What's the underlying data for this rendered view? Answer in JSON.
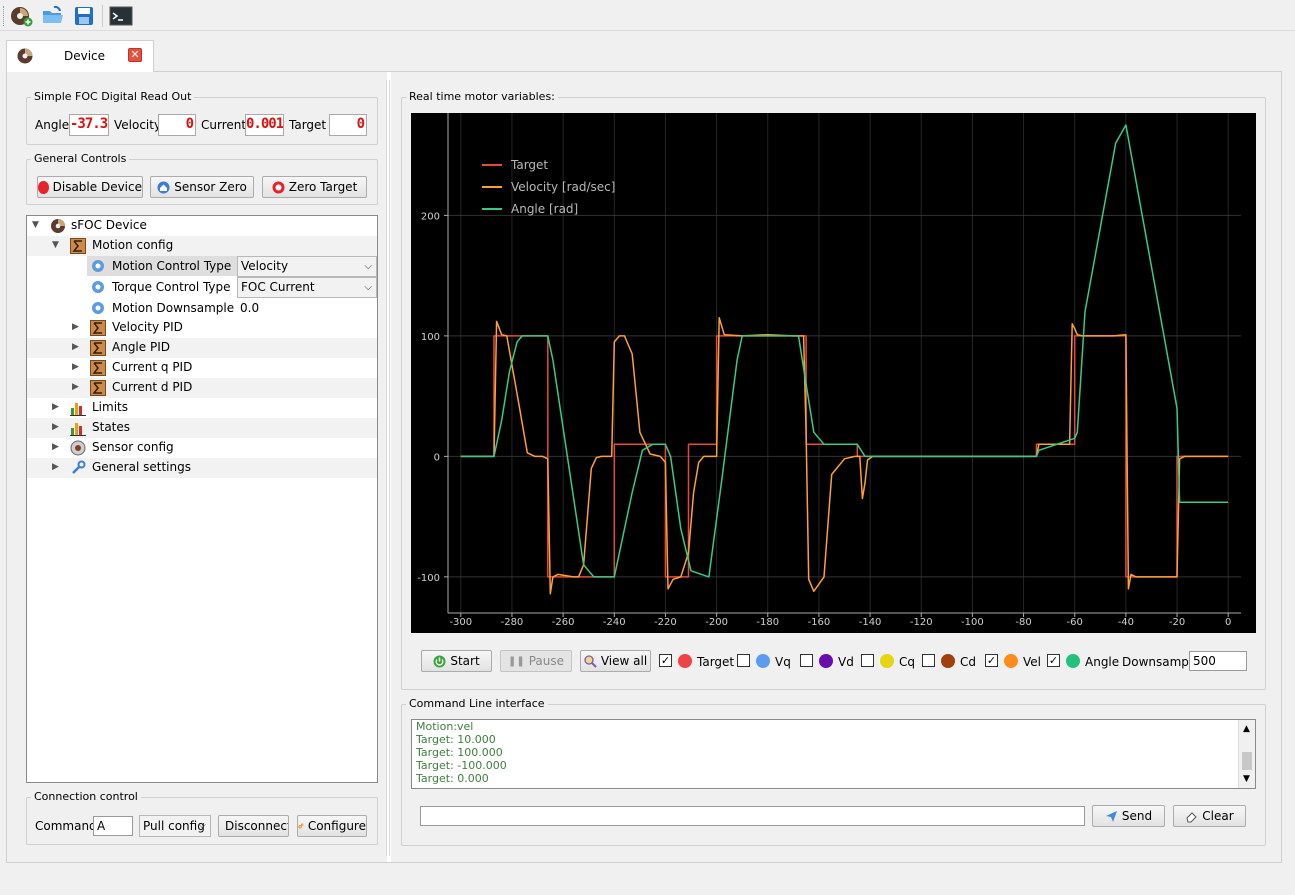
{
  "toolbar": {
    "icons": [
      "new-device-icon",
      "open-folder-icon",
      "save-icon",
      "terminal-icon"
    ]
  },
  "tab": {
    "label": "Device",
    "close_symbol": "✕"
  },
  "readout": {
    "title": "Simple FOC Digital Read Out",
    "angle_label": "Angle",
    "angle_value": "-37.3",
    "velocity_label": "Velocity",
    "velocity_value": "0",
    "current_label": "Current",
    "current_value": "0.001",
    "target_label": "Target",
    "target_value": "0"
  },
  "general_controls": {
    "title": "General Controls",
    "disable_label": "Disable Device",
    "sensor_zero_label": "Sensor Zero",
    "zero_target_label": "Zero Target"
  },
  "tree": {
    "root": "sFOC Device",
    "motion_config": "Motion config",
    "motion_control_type_label": "Motion Control Type",
    "motion_control_type_value": "Velocity",
    "torque_control_type_label": "Torque Control Type",
    "torque_control_type_value": "FOC Current",
    "motion_downsample_label": "Motion Downsample",
    "motion_downsample_value": "0.0",
    "velocity_pid": "Velocity PID",
    "angle_pid": "Angle PID",
    "current_q_pid": "Current q PID",
    "current_d_pid": "Current d PID",
    "limits": "Limits",
    "states": "States",
    "sensor_config": "Sensor config",
    "general_settings": "General settings"
  },
  "connection": {
    "title": "Connection control",
    "command_label": "Command:",
    "command_value": "A",
    "pull_config": "Pull config",
    "disconnect": "Disconnect",
    "configure": "Configure"
  },
  "plot_group": {
    "title": "Real time motor variables:"
  },
  "plot_controls": {
    "start": "Start",
    "pause": "Pause",
    "view_all": "View all",
    "downsample_label": "Downsample",
    "downsample_value": "500",
    "channels": [
      {
        "name": "Target",
        "checked": true,
        "color": "#ee4444"
      },
      {
        "name": "Vq",
        "checked": false,
        "color": "#5b9bf0"
      },
      {
        "name": "Vd",
        "checked": false,
        "color": "#6a0dad"
      },
      {
        "name": "Cq",
        "checked": false,
        "color": "#e8d410"
      },
      {
        "name": "Cd",
        "checked": false,
        "color": "#a0400a"
      },
      {
        "name": "Vel",
        "checked": true,
        "color": "#ff8c1a"
      },
      {
        "name": "Angle",
        "checked": true,
        "color": "#22c27a"
      }
    ]
  },
  "cli": {
    "title": "Command Line interface",
    "lines": [
      "Motion:vel",
      "Target: 10.000",
      "Target: 100.000",
      "Target: -100.000",
      "Target: 0.000"
    ],
    "input_value": "",
    "send": "Send",
    "clear": "Clear"
  },
  "chart_data": {
    "type": "line",
    "title": "",
    "xlabel": "",
    "ylabel": "",
    "xlim": [
      -305,
      5
    ],
    "ylim": [
      -130,
      285
    ],
    "x_ticks": [
      -300,
      -280,
      -260,
      -240,
      -220,
      -200,
      -180,
      -160,
      -140,
      -120,
      -100,
      -80,
      -60,
      -40,
      -20,
      0
    ],
    "y_ticks": [
      -100,
      0,
      100,
      200
    ],
    "grid": true,
    "legend_position": "top-left",
    "background": "#000000",
    "series": [
      {
        "name": "Target",
        "color": "#e84a3a",
        "x": [
          -300,
          -287,
          -287,
          -266,
          -266,
          -240,
          -240,
          -220,
          -220,
          -211,
          -211,
          -200,
          -200,
          -165,
          -165,
          -145,
          -145,
          -75,
          -75,
          -60,
          -60,
          -40,
          -40,
          -20,
          -20,
          0
        ],
        "y": [
          0,
          0,
          100,
          100,
          -100,
          -100,
          10,
          10,
          -100,
          -100,
          10,
          10,
          100,
          100,
          10,
          10,
          0,
          0,
          10,
          10,
          100,
          100,
          -100,
          -100,
          0,
          0
        ]
      },
      {
        "name": "Velocity [rad/sec]",
        "color": "#ffa033",
        "x": [
          -300,
          -287,
          -286,
          -284,
          -282,
          -277,
          -274,
          -271,
          -268,
          -266,
          -265,
          -264,
          -262,
          -256,
          -254,
          -252,
          -249,
          -247,
          -245,
          -241,
          -240,
          -238,
          -236,
          -233,
          -230,
          -226,
          -222,
          -220,
          -219,
          -217,
          -214,
          -211,
          -209,
          -207,
          -205,
          -203,
          -201,
          -200,
          -199,
          -197,
          -190,
          -180,
          -170,
          -166,
          -165,
          -164,
          -162,
          -158,
          -155,
          -150,
          -146,
          -144,
          -143,
          -142,
          -141,
          -139,
          -136,
          -130,
          -75,
          -74,
          -72,
          -62,
          -61,
          -60,
          -59,
          -57,
          -45,
          -40,
          -39,
          -38,
          -36,
          -24,
          -20,
          -19,
          -17,
          0
        ],
        "y": [
          0,
          0,
          112,
          101,
          100,
          40,
          3,
          0,
          0,
          -2,
          -114,
          -100,
          -98,
          -100,
          -100,
          -90,
          -10,
          -1,
          0,
          0,
          95,
          100,
          100,
          85,
          20,
          2,
          0,
          -5,
          -110,
          -102,
          -100,
          -80,
          -30,
          -5,
          0,
          0,
          0,
          0,
          115,
          101,
          100,
          101,
          100,
          100,
          20,
          -102,
          -112,
          -100,
          -15,
          -2,
          0,
          0,
          -35,
          -22,
          -3,
          0,
          0,
          0,
          0,
          10,
          10,
          10,
          110,
          106,
          101,
          100,
          100,
          101,
          -110,
          -98,
          -100,
          -100,
          -100,
          -2,
          0,
          0
        ]
      },
      {
        "name": "Angle [rad]",
        "color": "#36cc85",
        "x": [
          -300,
          -287,
          -284,
          -281,
          -278,
          -276,
          -266,
          -264,
          -252,
          -248,
          -240,
          -233,
          -229,
          -225,
          -220,
          -218,
          -214,
          -210,
          -203,
          -198,
          -192,
          -190,
          -180,
          -168,
          -165,
          -162,
          -158,
          -145,
          -142,
          -141,
          -139,
          -136,
          -75,
          -74,
          -60,
          -59,
          -56,
          -44,
          -40,
          -20,
          -19,
          -17,
          0
        ],
        "y": [
          0,
          0,
          30,
          70,
          95,
          100,
          100,
          80,
          -90,
          -100,
          -100,
          -30,
          5,
          10,
          10,
          0,
          -60,
          -95,
          -100,
          -20,
          80,
          100,
          100,
          100,
          60,
          20,
          10,
          10,
          0,
          0,
          0,
          0,
          0,
          5,
          15,
          20,
          120,
          260,
          275,
          40,
          -38,
          -38,
          -38
        ]
      }
    ]
  }
}
